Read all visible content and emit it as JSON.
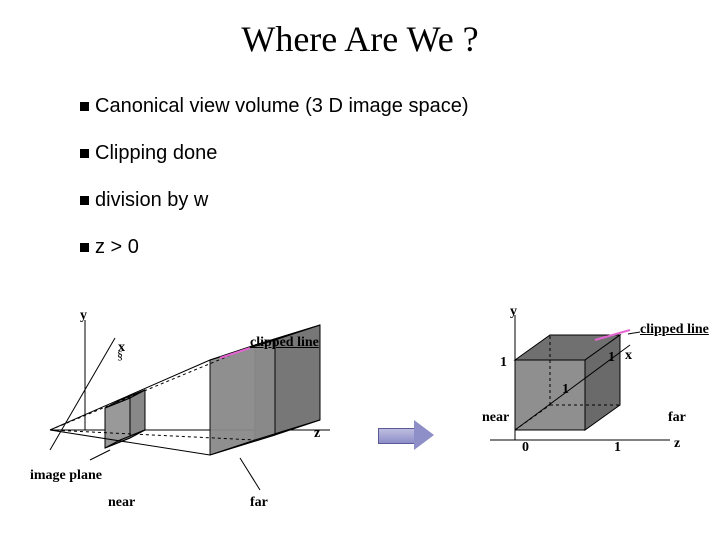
{
  "title": "Where Are We ?",
  "bullets": {
    "b1": "Canonical view volume (3 D image space)",
    "b2": "Clipping done",
    "b3": "division by w",
    "b4": "z > 0"
  },
  "left_diagram": {
    "y": "y",
    "x": "x",
    "z": "z",
    "clipped_line": "clipped line",
    "image_plane": "image plane",
    "near": "near",
    "far": "far"
  },
  "right_diagram": {
    "y": "y",
    "x": "x",
    "z": "z",
    "one_a": "1",
    "one_b": "1",
    "one_c": "1",
    "zero": "0",
    "one_d": "1",
    "near": "near",
    "far": "far",
    "clipped_line": "clipped line"
  }
}
